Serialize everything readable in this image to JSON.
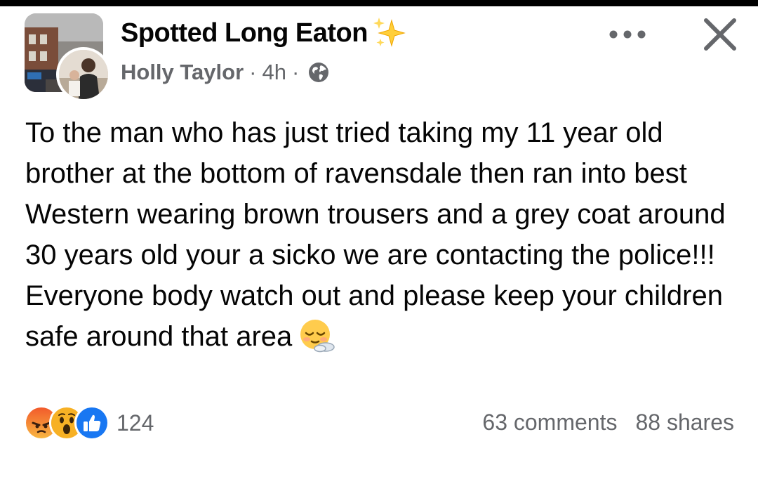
{
  "post": {
    "group_name": "Spotted Long Eaton",
    "author": "Holly Taylor",
    "separator": "·",
    "time": "4h",
    "body_text": "To the man who has just tried taking my 11 year old brother at the bottom of ravensdale then ran into best Western wearing brown trousers and a grey coat around 30 years old your a sicko we are contacting the police!!! Everyone body watch out and please keep your children safe around that area",
    "body_emoji": "relieved-face-emoji",
    "icons": {
      "group_name_decoration": "sparkles-icon",
      "privacy": "globe-icon",
      "more": "more-options-icon",
      "close": "close-icon"
    }
  },
  "reactions": {
    "types": [
      "angry-reaction-icon",
      "wow-reaction-icon",
      "like-reaction-icon"
    ],
    "count": "124"
  },
  "stats": {
    "comments": "63 comments",
    "shares": "88 shares"
  },
  "colors": {
    "primary_text": "#050505",
    "secondary_text": "#65676b",
    "like_blue": "#1877f2",
    "angry_orange": "#e9710f",
    "wow_yellow": "#f7b125"
  }
}
